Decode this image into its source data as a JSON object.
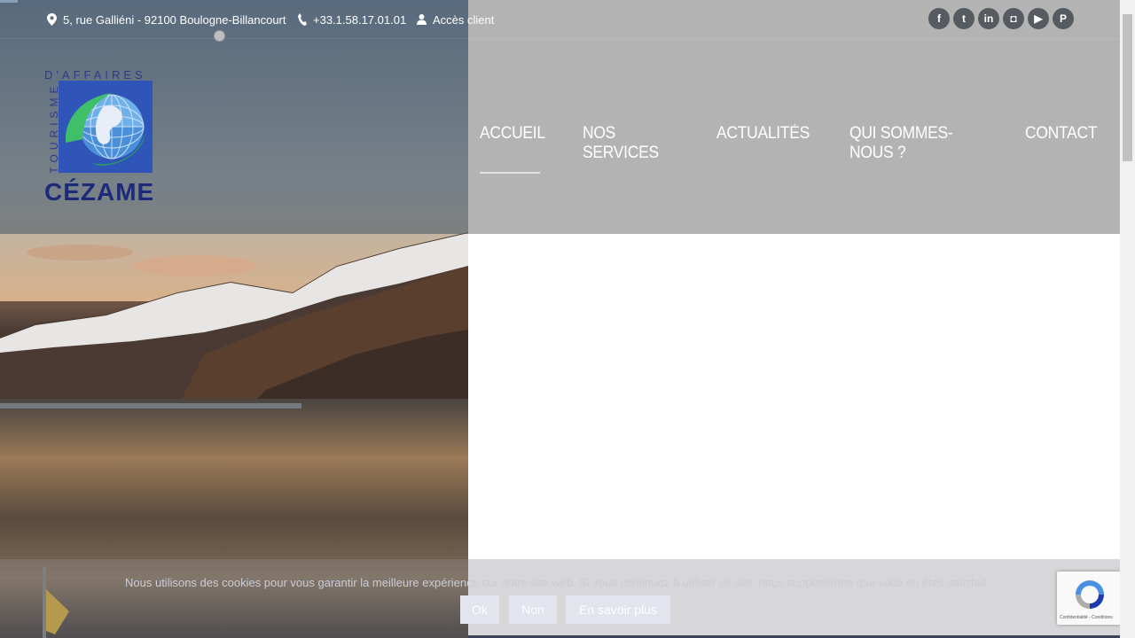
{
  "topbar": {
    "address": "5, rue Galliéni - 92100 Boulogne-Billancourt",
    "phone": "+33.1.58.17.01.01",
    "client_access": "Accès client"
  },
  "social": [
    {
      "name": "facebook-icon",
      "glyph": "f"
    },
    {
      "name": "twitter-icon",
      "glyph": "t"
    },
    {
      "name": "linkedin-icon",
      "glyph": "in"
    },
    {
      "name": "instagram-icon",
      "glyph": "◘"
    },
    {
      "name": "youtube-icon",
      "glyph": "▶"
    },
    {
      "name": "pinterest-icon",
      "glyph": "P"
    }
  ],
  "logo": {
    "top_text": "D'AFFAIRES",
    "side_text": "TOURISME",
    "brand": "CÉZAME"
  },
  "nav": [
    {
      "label": "ACCUEIL",
      "active": true
    },
    {
      "label": "NOS SERVICES",
      "active": false
    },
    {
      "label": "ACTUALITÉS",
      "active": false
    },
    {
      "label": "QUI SOMMES-NOUS ?",
      "active": false
    },
    {
      "label": "CONTACT",
      "active": false
    }
  ],
  "cookie": {
    "message": "Nous utilisons des cookies pour vous garantir la meilleure expérience sur notre site web. Si vous continuez à utiliser ce site, nous supposerons que vous en êtes satisfait.",
    "ok": "Ok",
    "no": "Non",
    "more": "En savoir plus"
  },
  "recaptcha": {
    "footer": "Confidentialité - Conditions"
  },
  "colors": {
    "brand_blue": "#2c3a8c",
    "header_gray": "#b3b3b3",
    "icon_gray": "#555b60"
  }
}
